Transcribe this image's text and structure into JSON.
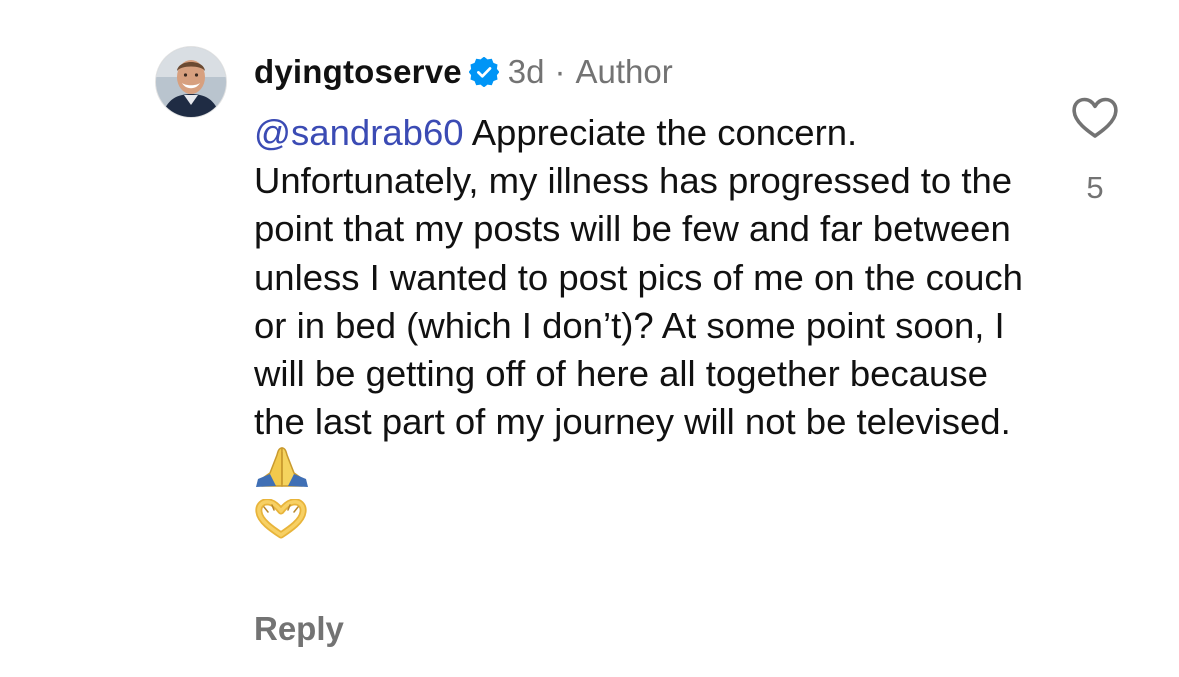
{
  "comment": {
    "username": "dyingtoserve",
    "verified": true,
    "time": "3d",
    "separator": "·",
    "role_badge": "Author",
    "mention": "@sandrab60",
    "text": " Appreciate the concern. Unfortunately, my illness has progressed to the point that my posts will be few and far between unless I wanted to post pics of me on the couch or in bed (which I don’t)? At some point soon, I will be getting off of here all together because the last part of my journey will not be televised. ",
    "emojis": [
      "folded-hands",
      "heart-hands"
    ],
    "reply_label": "Reply",
    "likes": "5"
  },
  "colors": {
    "mention": "#3b4bb4",
    "verified": "#0095f6",
    "secondary_text": "#737373",
    "primary_text": "#111111"
  },
  "icons": {
    "avatar": "profile-avatar",
    "verified": "verified-badge-icon",
    "like": "heart-outline-icon"
  }
}
